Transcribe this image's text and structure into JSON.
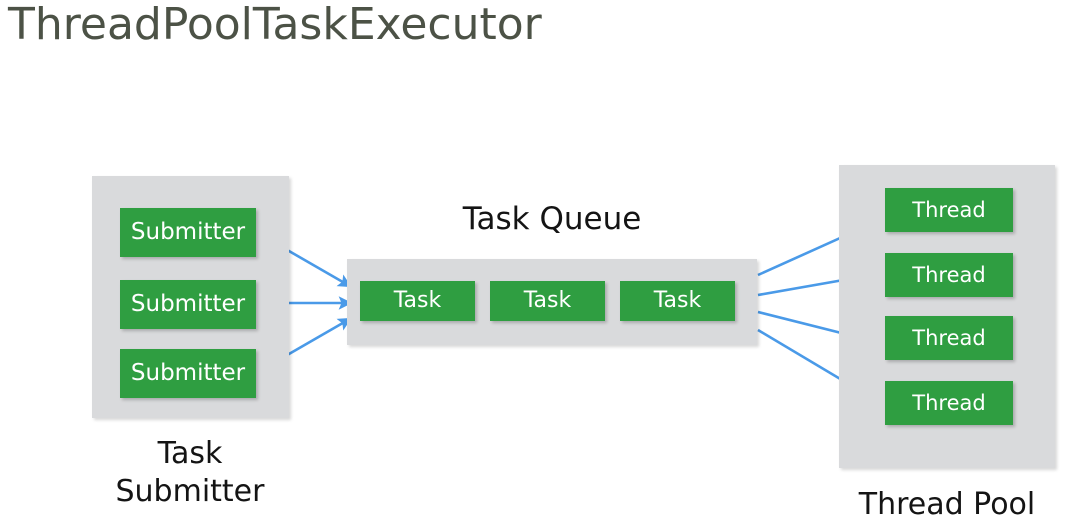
{
  "page": {
    "title": "ThreadPoolTaskExecutor",
    "background_color": "#ffffff"
  },
  "colors": {
    "title_text": "#4c5246",
    "panel_fill": "#d9dadc",
    "box_fill": "#2f9e41",
    "box_text": "#ffffff",
    "arrow": "#4a9ae8",
    "caption_text": "#141414"
  },
  "diagram": {
    "type": "flow-diagram",
    "groups": [
      {
        "id": "task-submitter",
        "caption": "Task\nSubmitter",
        "caption_lines": [
          "Task",
          "Submitter"
        ],
        "items": [
          {
            "label": "Submitter"
          },
          {
            "label": "Submitter"
          },
          {
            "label": "Submitter"
          }
        ]
      },
      {
        "id": "task-queue",
        "caption": "Task Queue",
        "caption_position": "above",
        "items": [
          {
            "label": "Task"
          },
          {
            "label": "Task"
          },
          {
            "label": "Task"
          }
        ]
      },
      {
        "id": "thread-pool",
        "caption": "Thread Pool",
        "caption_position": "below",
        "items": [
          {
            "label": "Thread"
          },
          {
            "label": "Thread"
          },
          {
            "label": "Thread"
          },
          {
            "label": "Thread"
          }
        ]
      }
    ],
    "connections": [
      {
        "from": "submitter-0",
        "to": "task-queue",
        "style": "arrow"
      },
      {
        "from": "submitter-1",
        "to": "task-queue",
        "style": "arrow"
      },
      {
        "from": "submitter-2",
        "to": "task-queue",
        "style": "arrow"
      },
      {
        "from": "task-queue",
        "to": "thread-0",
        "style": "arrow"
      },
      {
        "from": "task-queue",
        "to": "thread-1",
        "style": "arrow"
      },
      {
        "from": "task-queue",
        "to": "thread-2",
        "style": "arrow"
      },
      {
        "from": "task-queue",
        "to": "thread-3",
        "style": "arrow"
      }
    ]
  }
}
